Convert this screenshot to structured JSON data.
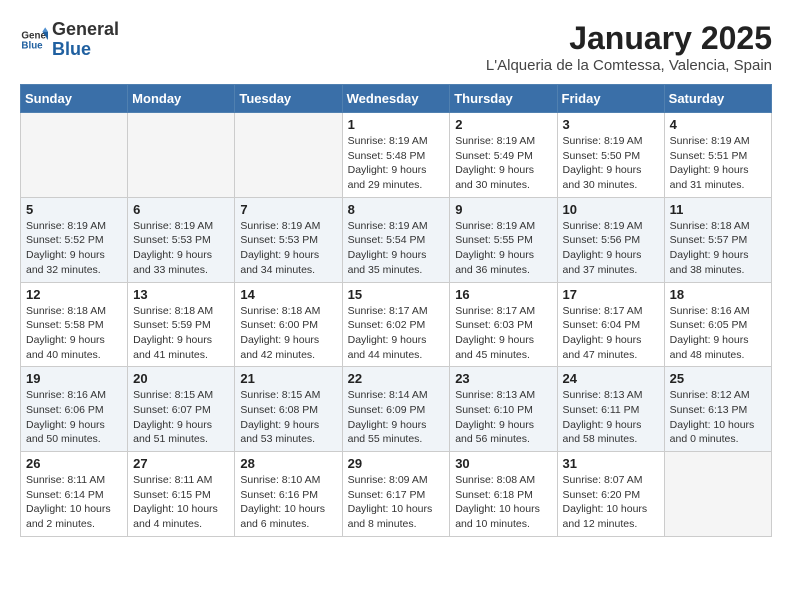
{
  "logo": {
    "general": "General",
    "blue": "Blue"
  },
  "title": "January 2025",
  "location": "L'Alqueria de la Comtessa, Valencia, Spain",
  "days_of_week": [
    "Sunday",
    "Monday",
    "Tuesday",
    "Wednesday",
    "Thursday",
    "Friday",
    "Saturday"
  ],
  "weeks": [
    [
      {
        "day": "",
        "info": ""
      },
      {
        "day": "",
        "info": ""
      },
      {
        "day": "",
        "info": ""
      },
      {
        "day": "1",
        "info": "Sunrise: 8:19 AM\nSunset: 5:48 PM\nDaylight: 9 hours\nand 29 minutes."
      },
      {
        "day": "2",
        "info": "Sunrise: 8:19 AM\nSunset: 5:49 PM\nDaylight: 9 hours\nand 30 minutes."
      },
      {
        "day": "3",
        "info": "Sunrise: 8:19 AM\nSunset: 5:50 PM\nDaylight: 9 hours\nand 30 minutes."
      },
      {
        "day": "4",
        "info": "Sunrise: 8:19 AM\nSunset: 5:51 PM\nDaylight: 9 hours\nand 31 minutes."
      }
    ],
    [
      {
        "day": "5",
        "info": "Sunrise: 8:19 AM\nSunset: 5:52 PM\nDaylight: 9 hours\nand 32 minutes."
      },
      {
        "day": "6",
        "info": "Sunrise: 8:19 AM\nSunset: 5:53 PM\nDaylight: 9 hours\nand 33 minutes."
      },
      {
        "day": "7",
        "info": "Sunrise: 8:19 AM\nSunset: 5:53 PM\nDaylight: 9 hours\nand 34 minutes."
      },
      {
        "day": "8",
        "info": "Sunrise: 8:19 AM\nSunset: 5:54 PM\nDaylight: 9 hours\nand 35 minutes."
      },
      {
        "day": "9",
        "info": "Sunrise: 8:19 AM\nSunset: 5:55 PM\nDaylight: 9 hours\nand 36 minutes."
      },
      {
        "day": "10",
        "info": "Sunrise: 8:19 AM\nSunset: 5:56 PM\nDaylight: 9 hours\nand 37 minutes."
      },
      {
        "day": "11",
        "info": "Sunrise: 8:18 AM\nSunset: 5:57 PM\nDaylight: 9 hours\nand 38 minutes."
      }
    ],
    [
      {
        "day": "12",
        "info": "Sunrise: 8:18 AM\nSunset: 5:58 PM\nDaylight: 9 hours\nand 40 minutes."
      },
      {
        "day": "13",
        "info": "Sunrise: 8:18 AM\nSunset: 5:59 PM\nDaylight: 9 hours\nand 41 minutes."
      },
      {
        "day": "14",
        "info": "Sunrise: 8:18 AM\nSunset: 6:00 PM\nDaylight: 9 hours\nand 42 minutes."
      },
      {
        "day": "15",
        "info": "Sunrise: 8:17 AM\nSunset: 6:02 PM\nDaylight: 9 hours\nand 44 minutes."
      },
      {
        "day": "16",
        "info": "Sunrise: 8:17 AM\nSunset: 6:03 PM\nDaylight: 9 hours\nand 45 minutes."
      },
      {
        "day": "17",
        "info": "Sunrise: 8:17 AM\nSunset: 6:04 PM\nDaylight: 9 hours\nand 47 minutes."
      },
      {
        "day": "18",
        "info": "Sunrise: 8:16 AM\nSunset: 6:05 PM\nDaylight: 9 hours\nand 48 minutes."
      }
    ],
    [
      {
        "day": "19",
        "info": "Sunrise: 8:16 AM\nSunset: 6:06 PM\nDaylight: 9 hours\nand 50 minutes."
      },
      {
        "day": "20",
        "info": "Sunrise: 8:15 AM\nSunset: 6:07 PM\nDaylight: 9 hours\nand 51 minutes."
      },
      {
        "day": "21",
        "info": "Sunrise: 8:15 AM\nSunset: 6:08 PM\nDaylight: 9 hours\nand 53 minutes."
      },
      {
        "day": "22",
        "info": "Sunrise: 8:14 AM\nSunset: 6:09 PM\nDaylight: 9 hours\nand 55 minutes."
      },
      {
        "day": "23",
        "info": "Sunrise: 8:13 AM\nSunset: 6:10 PM\nDaylight: 9 hours\nand 56 minutes."
      },
      {
        "day": "24",
        "info": "Sunrise: 8:13 AM\nSunset: 6:11 PM\nDaylight: 9 hours\nand 58 minutes."
      },
      {
        "day": "25",
        "info": "Sunrise: 8:12 AM\nSunset: 6:13 PM\nDaylight: 10 hours\nand 0 minutes."
      }
    ],
    [
      {
        "day": "26",
        "info": "Sunrise: 8:11 AM\nSunset: 6:14 PM\nDaylight: 10 hours\nand 2 minutes."
      },
      {
        "day": "27",
        "info": "Sunrise: 8:11 AM\nSunset: 6:15 PM\nDaylight: 10 hours\nand 4 minutes."
      },
      {
        "day": "28",
        "info": "Sunrise: 8:10 AM\nSunset: 6:16 PM\nDaylight: 10 hours\nand 6 minutes."
      },
      {
        "day": "29",
        "info": "Sunrise: 8:09 AM\nSunset: 6:17 PM\nDaylight: 10 hours\nand 8 minutes."
      },
      {
        "day": "30",
        "info": "Sunrise: 8:08 AM\nSunset: 6:18 PM\nDaylight: 10 hours\nand 10 minutes."
      },
      {
        "day": "31",
        "info": "Sunrise: 8:07 AM\nSunset: 6:20 PM\nDaylight: 10 hours\nand 12 minutes."
      },
      {
        "day": "",
        "info": ""
      }
    ]
  ]
}
